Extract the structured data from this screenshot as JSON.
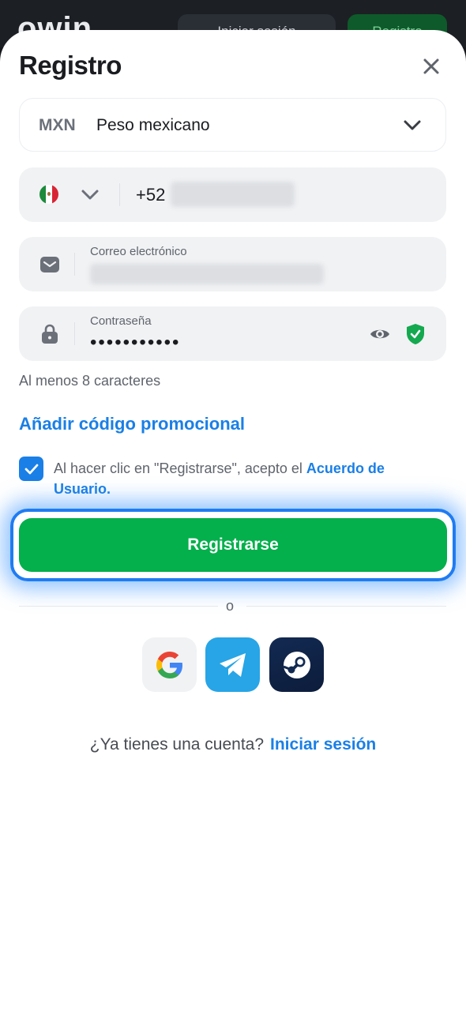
{
  "background": {
    "logo_text": "owin",
    "login_button": "Iniciar sesión",
    "register_button": "Registro"
  },
  "sheet": {
    "title": "Registro",
    "close_icon": "close-icon"
  },
  "currency": {
    "code": "MXN",
    "name": "Peso mexicano",
    "icon": "chevron-down-icon"
  },
  "phone": {
    "country_flag": "mexico-flag-icon",
    "prefix": "+52"
  },
  "email": {
    "label": "Correo electrónico"
  },
  "password": {
    "label": "Contraseña",
    "masked_value": "•••••••••••",
    "hint": "Al menos 8 caracteres"
  },
  "promo": {
    "label": "Añadir código promocional"
  },
  "consent": {
    "checked": true,
    "text": "Al hacer clic en \"Registrarse\", acepto el ",
    "link": "Acuerdo de Usuario."
  },
  "register": {
    "label": "Registrarse"
  },
  "divider": {
    "text": "o"
  },
  "social": [
    {
      "name": "google-icon"
    },
    {
      "name": "telegram-icon"
    },
    {
      "name": "steam-icon"
    }
  ],
  "signin": {
    "question": "¿Ya tienes una cuenta?",
    "link": "Iniciar sesión"
  },
  "colors": {
    "accent": "#1a7fe6",
    "primary_button": "#03b04c",
    "field_bg": "#f1f2f4"
  }
}
